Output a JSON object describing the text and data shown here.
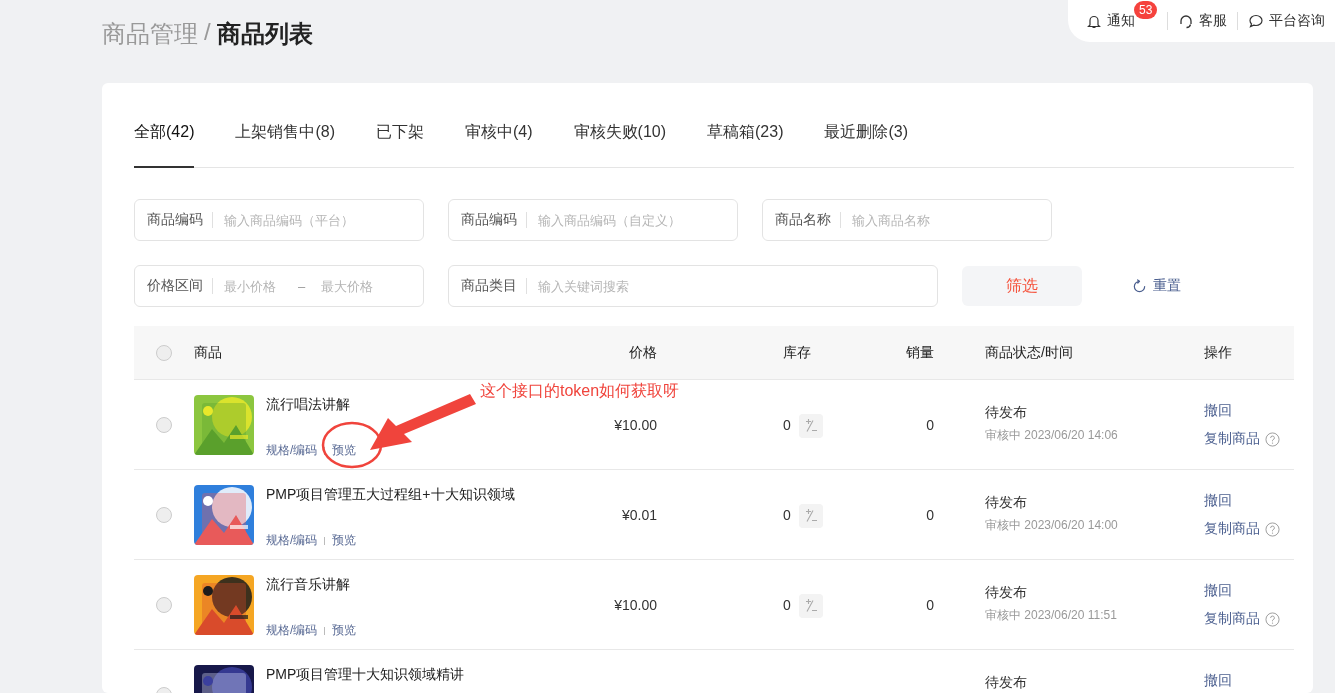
{
  "breadcrumb": {
    "parent": "商品管理",
    "separator": "/",
    "current": "商品列表"
  },
  "top_bar": {
    "items": [
      {
        "kind": "notification",
        "label": "通知",
        "badge": "53"
      },
      {
        "kind": "service",
        "label": "客服"
      },
      {
        "kind": "chat",
        "label": "平台咨询"
      }
    ]
  },
  "tabs": [
    {
      "label": "全部(42)",
      "selected": true
    },
    {
      "label": "上架销售中(8)",
      "selected": false
    },
    {
      "label": "已下架",
      "selected": false
    },
    {
      "label": "审核中(4)",
      "selected": false
    },
    {
      "label": "审核失败(10)",
      "selected": false
    },
    {
      "label": "草稿箱(23)",
      "selected": false
    },
    {
      "label": "最近删除(3)",
      "selected": false
    }
  ],
  "filter_rows": [
    [
      {
        "kind": "text",
        "label": "商品编码",
        "placeholder": "输入商品编码（平台）"
      },
      {
        "kind": "text",
        "label": "商品编码",
        "placeholder": "输入商品编码（自定义）"
      },
      {
        "kind": "text",
        "label": "商品名称",
        "placeholder": "输入商品名称"
      }
    ],
    [
      {
        "kind": "range",
        "label": "价格区间",
        "placeholder_min": "最小价格",
        "separator": "–",
        "placeholder_max": "最大价格"
      },
      {
        "kind": "text",
        "label": "商品类目",
        "placeholder": "输入关键词搜索"
      }
    ]
  ],
  "filter_button": "筛选",
  "reset_button": "重置",
  "table": {
    "select_all": {
      "checked": false
    },
    "columns": [
      "商品",
      "价格",
      "库存",
      "销量",
      "商品状态/时间",
      "操作"
    ],
    "rows": [
      {
        "checked": false,
        "image": {
          "kind": "picture"
        },
        "title": "流行唱法讲解",
        "links": [
          "规格/编码",
          "预览"
        ],
        "price": "¥10.00",
        "stock": "0",
        "sales": "0",
        "status": "待发布",
        "status_detail": "审核中 2023/06/20 14:06",
        "actions": [
          {
            "label": "撤回",
            "kind": "plain"
          },
          {
            "label": "复制商品",
            "kind": "help"
          }
        ]
      },
      {
        "checked": false,
        "image": {
          "kind": "picture"
        },
        "title": "PMP项目管理五大过程组+十大知识领域",
        "links": [
          "规格/编码",
          "预览"
        ],
        "price": "¥0.01",
        "stock": "0",
        "sales": "0",
        "status": "待发布",
        "status_detail": "审核中 2023/06/20 14:00",
        "actions": [
          {
            "label": "撤回",
            "kind": "plain"
          },
          {
            "label": "复制商品",
            "kind": "help"
          }
        ]
      },
      {
        "checked": false,
        "image": {
          "kind": "picture"
        },
        "title": "流行音乐讲解",
        "links": [
          "规格/编码",
          "预览"
        ],
        "price": "¥10.00",
        "stock": "0",
        "sales": "0",
        "status": "待发布",
        "status_detail": "审核中 2023/06/20 11:51",
        "actions": [
          {
            "label": "撤回",
            "kind": "plain"
          },
          {
            "label": "复制商品",
            "kind": "help"
          }
        ]
      },
      {
        "checked": false,
        "image": {
          "kind": "picture"
        },
        "title": "PMP项目管理十大知识领域精讲",
        "status": "待发布",
        "actions": [
          {
            "label": "撤回",
            "kind": "plain"
          }
        ]
      }
    ]
  },
  "annotation": {
    "text": "这个接口的token如何获取呀"
  }
}
